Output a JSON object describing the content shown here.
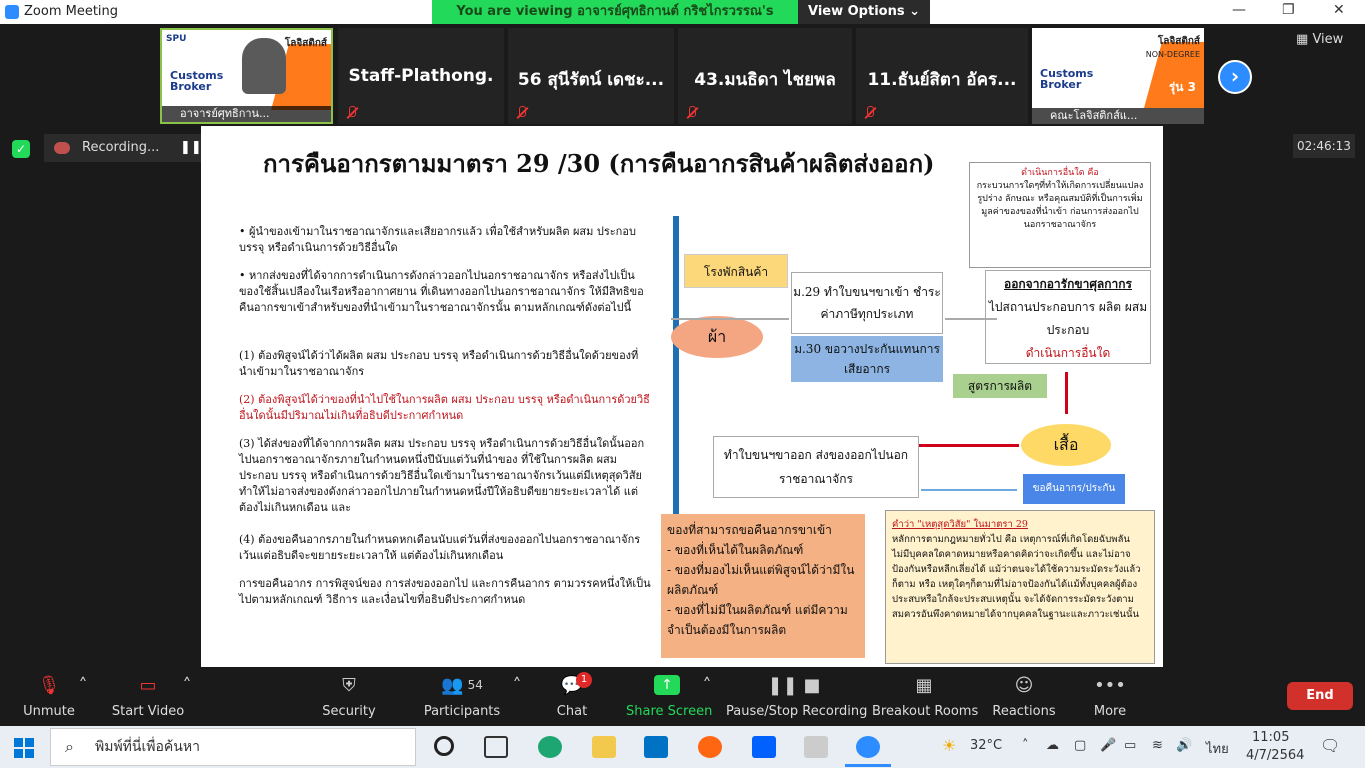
{
  "window": {
    "title": "Zoom Meeting"
  },
  "banner": {
    "viewing": "You are viewing อาจารย์ศุทธิกานต์  กริชไกรวรรณ's screen",
    "view_options": "View Options ⌄"
  },
  "top": {
    "view_label": "View"
  },
  "participants": [
    {
      "name": "อาจารย์ศุทธิกาน...",
      "type": "video"
    },
    {
      "name": "Staff-Plathong.",
      "type": "name"
    },
    {
      "name": "56 สุนีรัตน์ เดชะ...",
      "type": "name"
    },
    {
      "name": "43.มนธิดา ไชยพล",
      "type": "name"
    },
    {
      "name": "11.ธันย์สิตา อัคร...",
      "type": "name"
    },
    {
      "name": "คณะโลจิสติกส์แ...",
      "type": "video"
    }
  ],
  "poster": {
    "brand": "SPU",
    "title": "โลจิสติกส์",
    "line1": "Customs",
    "line2": "Broker",
    "round": "รุ่น 3",
    "nondegree": "NON-DEGREE"
  },
  "recording": {
    "label": "Recording..."
  },
  "timer": "02:46:13",
  "slide": {
    "title": "การคืนอากรตามมาตรา 29 /30 (การคืนอากรสินค้าผลิตส่งออก)",
    "p1": "ผู้นำของเข้ามาในราชอาณาจักรและเสียอากรแล้ว เพื่อใช้สำหรับผลิต ผสม ประกอบ บรรจุ หรือดำเนินการด้วยวิธีอื่นใด",
    "p2": "หากส่งของที่ได้จากการดำเนินการดังกล่าวออกไปนอกราชอาณาจักร หรือส่งไปเป็นของใช้สิ้นเปลืองในเรือหรืออากาศยาน ที่เดินทางออกไปนอกราชอาณาจักร ให้มีสิทธิขอคืนอากรขาเข้าสำหรับของที่นำเข้ามาในราชอาณาจักรนั้น ตามหลักเกณฑ์ดังต่อไปนี้",
    "p3": "(1) ต้องพิสูจน์ได้ว่าได้ผลิต ผสม ประกอบ บรรจุ หรือดำเนินการด้วยวิธีอื่นใดด้วยของที่นำเข้ามาในราชอาณาจักร",
    "p4": "(2) ต้องพิสูจน์ได้ว่าของที่นำไปใช้ในการผลิต ผสม ประกอบ บรรจุ หรือดำเนินการด้วยวิธีอื่นใดนั้นมีปริมาณไม่เกินที่อธิบดีประกาศกำหนด",
    "p5": "(3) ได้ส่งของที่ได้จากการผลิต ผสม ประกอบ บรรจุ หรือดำเนินการด้วยวิธีอื่นใดนั้นออกไปนอกราชอาณาจักรภายในกำหนดหนึ่งปีนับแต่วันที่นำของ ที่ใช้ในการผลิต ผสม ประกอบ บรรจุ หรือดำเนินการด้วยวิธีอื่นใดเข้ามาในราชอาณาจักรเว้นแต่มีเหตุสุดวิสัยทำให้ไม่อาจส่งของดังกล่าวออกไปภายในกำหนดหนึ่งปีให้อธิบดีขยายระยะเวลาได้ แต่ต้องไม่เกินหกเดือน และ",
    "p6": "(4) ต้องขอคืนอากรภายในกำหนดหกเดือนนับแต่วันที่ส่งของออกไปนอกราชอาณาจักร เว้นแต่อธิบดีจะขยายระยะเวลาให้ แต่ต้องไม่เกินหกเดือน",
    "p7": "การขอคืนอากร การพิสูจน์ของ การส่งของออกไป และการคืนอากร ตามวรรคหนึ่งให้เป็นไปตามหลักเกณฑ์ วิธีการ และเงื่อนไขที่อธิบดีประกาศกำหนด",
    "note_title": "ดำเนินการอื่นใด คือ",
    "note_body": "กระบวนการใดๆที่ทำให้เกิดการเปลี่ยนแปลงรูปร่าง ลักษณะ หรือคุณสมบัติที่เป็นการเพิ่มมูลค่าของของที่นำเข้า ก่อนการส่งออกไปนอกราชอาณาจักร",
    "factory": "โรงพักสินค้า",
    "fabric": "ผ้า",
    "m29": "ม.29 ทำใบขนฯขาเข้า ชำระค่าภาษีทุกประเภท",
    "m30": "ม.30 ขอวางประกันแทนการเสียอากร",
    "bonded_title": "ออกจากอารักขาศุลกากร",
    "bonded_body": "ไปสถานประกอบการ ผลิต ผสม ประกอบ",
    "bonded_red": "ดำเนินการอื่นใด",
    "formula": "สูตรการผลิต",
    "shirt": "เสื้อ",
    "export": "ทำใบขนฯขาออก ส่งของออกไปนอกราชอาณาจักร",
    "refund": "ขอคืนอากร/ประกัน",
    "refundable_title": "ของที่สามารถขอคืนอากรขาเข้า",
    "refundable_items": [
      "ของที่เห็นได้ในผลิตภัณฑ์",
      "ของที่มองไม่เห็นแต่พิสูจน์ได้ว่ามีในผลิตภัณฑ์",
      "ของที่ไม่มีในผลิตภัณฑ์ แต่มีความจำเป็นต้องมีในการผลิต"
    ],
    "force_title": "คำว่า \"เหตุสุดวิสัย\" ในมาตรา 29",
    "force_body": "หลักการตามกฎหมายทั่วไป คือ เหตุการณ์ที่เกิดโดยฉับพลัน ไม่มีบุคคลใดคาดหมายหรือคาดคิดว่าจะเกิดขึ้น และไม่อาจป้องกันหรือหลีกเลี่ยงได้ แม้ว่าตนจะได้ใช้ความระมัดระวังแล้วก็ตาม หรือ เหตุใดๆก็ตามที่ไม่อาจป้องกันได้แม้ทั้งบุคคลผู้ต้องประสบหรือใกล้จะประสบเหตุนั้น จะได้จัดการระมัดระวังตามสมควรอันพึงคาดหมายได้จากบุคคลในฐานะและภาวะเช่นนั้น"
  },
  "toolbar": {
    "unmute": "Unmute",
    "start_video": "Start Video",
    "security": "Security",
    "participants": "Participants",
    "participants_count": "54",
    "chat": "Chat",
    "chat_badge": "1",
    "share": "Share Screen",
    "pause": "Pause/Stop Recording",
    "breakout": "Breakout Rooms",
    "reactions": "Reactions",
    "more": "More",
    "end": "End"
  },
  "taskbar": {
    "search_placeholder": "พิมพ์ที่นี่เพื่อค้นหา",
    "temp": "32°C",
    "lang": "ไทย",
    "time": "11:05",
    "date": "4/7/2564"
  },
  "colors": {
    "zoom_blue": "#2d8cff",
    "banner_green": "#23d959",
    "end_red": "#d2302a",
    "share_green": "#23d959"
  }
}
